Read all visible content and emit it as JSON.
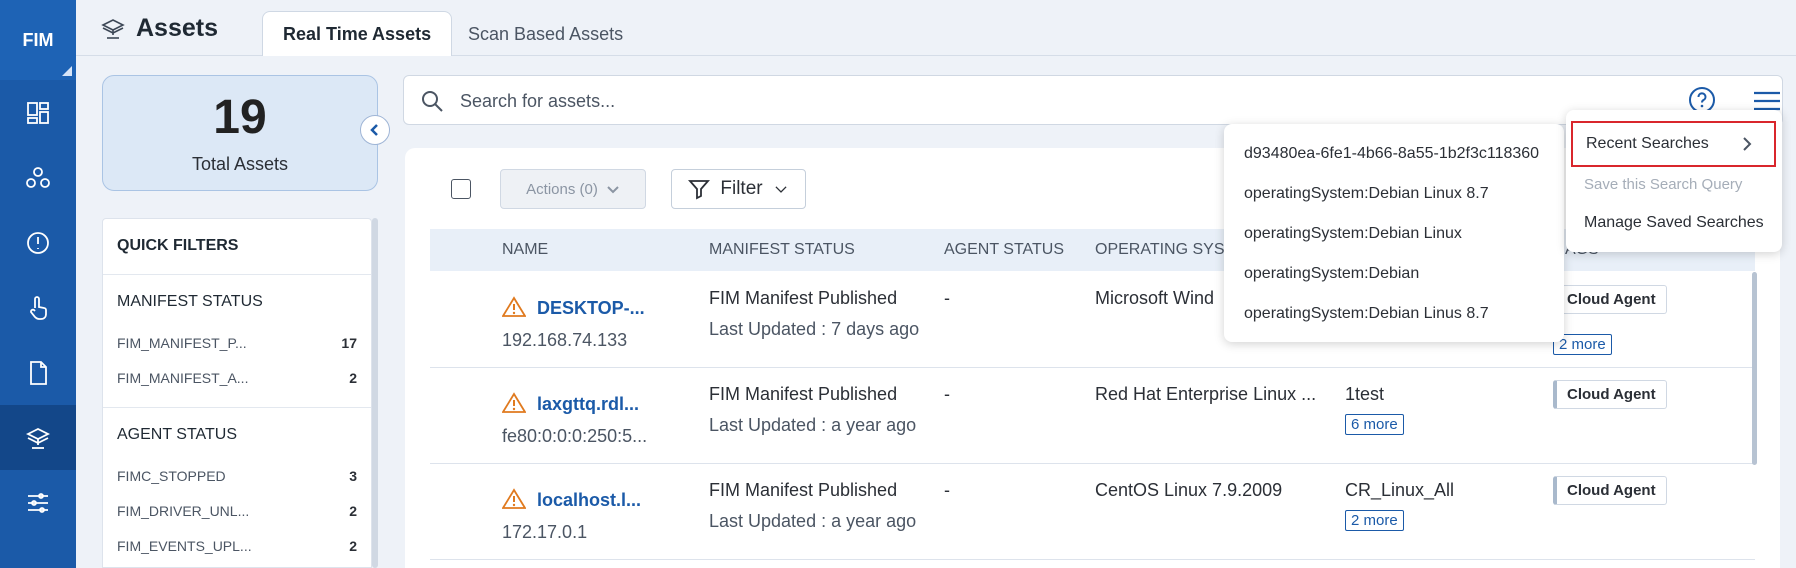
{
  "app": {
    "brand": "FIM",
    "page_title": "Assets"
  },
  "tabs": [
    {
      "label": "Real Time Assets",
      "active": true
    },
    {
      "label": "Scan Based Assets",
      "active": false
    }
  ],
  "summary": {
    "total": "19",
    "label": "Total Assets"
  },
  "quick_filters": {
    "title": "QUICK FILTERS",
    "sections": [
      {
        "title": "MANIFEST STATUS",
        "items": [
          {
            "label": "FIM_MANIFEST_P...",
            "count": "17"
          },
          {
            "label": "FIM_MANIFEST_A...",
            "count": "2"
          }
        ]
      },
      {
        "title": "AGENT STATUS",
        "items": [
          {
            "label": "FIMC_STOPPED",
            "count": "3"
          },
          {
            "label": "FIM_DRIVER_UNL...",
            "count": "2"
          },
          {
            "label": "FIM_EVENTS_UPL...",
            "count": "2"
          }
        ]
      }
    ]
  },
  "search": {
    "placeholder": "Search for assets...",
    "value": ""
  },
  "toolbar": {
    "actions_label": "Actions (0)",
    "filter_label": "Filter"
  },
  "table": {
    "columns": [
      "NAME",
      "MANIFEST STATUS",
      "AGENT STATUS",
      "OPERATING SYSTE",
      "AGS"
    ],
    "rows": [
      {
        "name": "DESKTOP-...",
        "address": "192.168.74.133",
        "manifest": "FIM Manifest Published",
        "updated": "Last Updated : 7 days ago",
        "agent_status": "-",
        "os": "Microsoft Wind",
        "tag1": "",
        "tag_more": "",
        "tag": "Cloud Agent",
        "tag_extra": "2 more"
      },
      {
        "name": "laxgttq.rdl...",
        "address": "fe80:0:0:0:250:5...",
        "manifest": "FIM Manifest Published",
        "updated": "Last Updated : a year ago",
        "agent_status": "-",
        "os": "Red Hat Enterprise Linux ...",
        "tag1": "1test",
        "tag_more": "6 more",
        "tag": "Cloud Agent",
        "tag_extra": ""
      },
      {
        "name": "localhost.l...",
        "address": "172.17.0.1",
        "manifest": "FIM Manifest Published",
        "updated": "Last Updated : a year ago",
        "agent_status": "-",
        "os": "CentOS Linux 7.9.2009",
        "tag1": "CR_Linux_All",
        "tag_more": "2 more",
        "tag": "Cloud Agent",
        "tag_extra": ""
      }
    ]
  },
  "recent_searches": [
    "d93480ea-6fe1-4b66-8a55-1b2f3c118360",
    "operatingSystem:Debian Linux 8.7",
    "operatingSystem:Debian Linux",
    "operatingSystem:Debian",
    "operatingSystem:Debian Linus 8.7"
  ],
  "menu": {
    "recent_label": "Recent Searches",
    "save_label": "Save this Search Query",
    "manage_label": "Manage Saved Searches"
  },
  "colors": {
    "nav": "#1b5aa8",
    "link": "#1b5aa8",
    "highlight": "#d9262c"
  }
}
